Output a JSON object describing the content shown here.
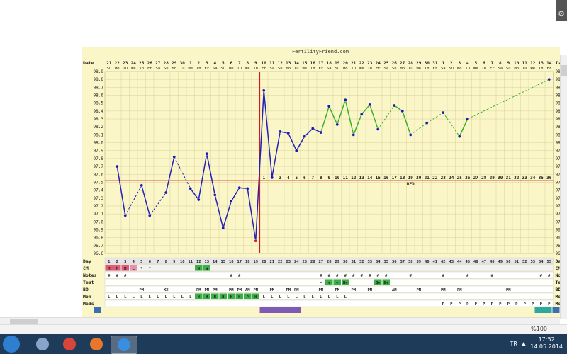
{
  "app": {
    "zoom": "%100",
    "lang": "TR",
    "time": "17:52",
    "date": "14.05.2014"
  },
  "chart": {
    "title": "FertilityFriend.com",
    "row_labels": {
      "date": "Date",
      "day": "Day",
      "cm": "CM",
      "notes": "Notes",
      "test": "Test",
      "bd": "BD",
      "mon": "Mon",
      "meds": "Meds"
    },
    "coverline": 97.52,
    "ovulation_cd": 19,
    "bfo_label": "BFO",
    "ymin": 96.6,
    "ymax": 98.9,
    "yticks": [
      "98.9",
      "98.8",
      "98.7",
      "98.6",
      "98.5",
      "98.4",
      "98.3",
      "98.2",
      "98.1",
      "98.0",
      "97.9",
      "97.8",
      "97.7",
      "97.6",
      "97.5",
      "97.4",
      "97.3",
      "97.2",
      "97.1",
      "97.0",
      "96.9",
      "96.8",
      "96.7",
      "96.6"
    ],
    "dates": [
      "21",
      "22",
      "23",
      "24",
      "25",
      "26",
      "27",
      "28",
      "29",
      "30",
      "1",
      "2",
      "3",
      "4",
      "5",
      "6",
      "7",
      "8",
      "9",
      "10",
      "11",
      "12",
      "13",
      "14",
      "15",
      "16",
      "17",
      "18",
      "19",
      "20",
      "21",
      "22",
      "23",
      "24",
      "25",
      "26",
      "27",
      "28",
      "29",
      "30",
      "31",
      "1",
      "2",
      "3",
      "4",
      "5",
      "6",
      "7",
      "8",
      "9",
      "10",
      "11",
      "12",
      "13",
      "14"
    ],
    "weekdays": [
      "Su",
      "Mo",
      "Tu",
      "We",
      "Th",
      "Fr",
      "Sa",
      "Su",
      "Mo",
      "Tu",
      "We",
      "Th",
      "Fr",
      "Sa",
      "Su",
      "Mo",
      "Tu",
      "We",
      "Th",
      "Fr",
      "Sa",
      "Su",
      "Mo",
      "Tu",
      "We",
      "Th",
      "Fr",
      "Sa",
      "Su",
      "Mo",
      "Tu",
      "We",
      "Th",
      "Fr",
      "Sa",
      "Su",
      "Mo",
      "Tu",
      "We",
      "Th",
      "Fr",
      "Sa",
      "Su",
      "Mo",
      "Tu",
      "We",
      "Th",
      "Fr",
      "Sa",
      "Su",
      "Mo",
      "Tu",
      "We",
      "Th",
      "Fr"
    ],
    "dpo": [
      "1",
      "2",
      "3",
      "4",
      "5",
      "6",
      "7",
      "8",
      "9",
      "10",
      "11",
      "12",
      "13",
      "14",
      "15",
      "16",
      "17",
      "18",
      "19",
      "20",
      "21",
      "22",
      "23",
      "24",
      "25",
      "26",
      "27",
      "28",
      "29",
      "30",
      "31",
      "32",
      "33",
      "34",
      "35",
      "36"
    ],
    "cycle_days": [
      "1",
      "2",
      "3",
      "4",
      "5",
      "6",
      "7",
      "8",
      "9",
      "10",
      "11",
      "12",
      "13",
      "14",
      "15",
      "16",
      "17",
      "18",
      "19",
      "20",
      "21",
      "22",
      "23",
      "24",
      "25",
      "26",
      "27",
      "28",
      "29",
      "30",
      "31",
      "32",
      "33",
      "34",
      "35",
      "36",
      "37",
      "38",
      "39",
      "40",
      "41",
      "42",
      "43",
      "44",
      "45",
      "46",
      "47",
      "48",
      "49",
      "50",
      "51",
      "52",
      "53",
      "54",
      "55"
    ],
    "cm": [
      "M",
      "M",
      "M",
      "L",
      "*",
      "*",
      "",
      "",
      "",
      "",
      "",
      "W",
      "W",
      "",
      "",
      "",
      "",
      "",
      "",
      "",
      "",
      "",
      "",
      "",
      "",
      "",
      "",
      "",
      "",
      "",
      "",
      "",
      "",
      "",
      "",
      "",
      "",
      "",
      "",
      "",
      "",
      "",
      "",
      "",
      "",
      "",
      "",
      "",
      "",
      "",
      "",
      "",
      "",
      "",
      ""
    ],
    "notes": [
      "#",
      "#",
      "#",
      "",
      "",
      "",
      "",
      "",
      "",
      "",
      "",
      "",
      "",
      "",
      "",
      "#",
      "#",
      "",
      "",
      "",
      "",
      "",
      "",
      "",
      "",
      "",
      "#",
      "#",
      "#",
      "#",
      "#",
      "#",
      "#",
      "#",
      "#",
      "",
      "",
      "#",
      "",
      "",
      "",
      "#",
      "",
      "",
      "#",
      "",
      "",
      "#",
      "",
      "",
      "",
      "",
      "",
      "#",
      "#"
    ],
    "test": [
      "",
      "",
      "",
      "",
      "",
      "",
      "",
      "",
      "",
      "",
      "",
      "",
      "",
      "",
      "",
      "",
      "",
      "",
      "",
      "",
      "",
      "",
      "",
      "",
      "",
      "",
      "–",
      "+",
      "+",
      "B+",
      "",
      "",
      "",
      "B+",
      "B+",
      "",
      "",
      "",
      "",
      "",
      "",
      "",
      "",
      "",
      "",
      "",
      "",
      "",
      "",
      "",
      "",
      "",
      "",
      "",
      ""
    ],
    "bd": [
      "",
      "",
      "",
      "",
      "PM",
      "",
      "",
      "XX",
      "",
      "",
      "",
      "PM",
      "PM",
      "PM",
      "",
      "PM",
      "PM",
      "AM",
      "PM",
      "",
      "PM",
      "",
      "PM",
      "PM",
      "",
      "",
      "PM",
      "",
      "PM",
      "",
      "PM",
      "",
      "PM",
      "",
      "",
      "AM",
      "",
      "",
      "PM",
      "",
      "",
      "PM",
      "",
      "PM",
      "",
      "",
      "",
      "",
      "",
      "PM",
      "",
      "",
      "",
      "",
      ""
    ],
    "mon": [
      "L",
      "L",
      "L",
      "L",
      "L",
      "L",
      "L",
      "L",
      "L",
      "L",
      "L",
      "H",
      "H",
      "H",
      "H",
      "H",
      "H",
      "P",
      "H",
      "L",
      "L",
      "L",
      "L",
      "L",
      "L",
      "L",
      "L",
      "L",
      "L",
      "L",
      "",
      "",
      "",
      "",
      "",
      "",
      "",
      "",
      "",
      "",
      "",
      "",
      "",
      "",
      "",
      "",
      "",
      "",
      "",
      "",
      "",
      "",
      "",
      "",
      ""
    ],
    "meds": [
      "",
      "",
      "",
      "",
      "",
      "",
      "",
      "",
      "",
      "",
      "",
      "",
      "",
      "",
      "",
      "",
      "",
      "",
      "",
      "",
      "",
      "",
      "",
      "",
      "",
      "",
      "",
      "",
      "",
      "",
      "",
      "",
      "",
      "",
      "",
      "",
      "",
      "",
      "",
      "",
      "",
      "P",
      "P",
      "P",
      "P",
      "P",
      "P",
      "P",
      "P",
      "P",
      "P",
      "P",
      "P",
      "P",
      "P"
    ]
  },
  "chart_data": {
    "type": "line",
    "title": "FertilityFriend.com",
    "xlabel": "",
    "ylabel": "",
    "ylim": [
      96.6,
      98.9
    ],
    "grid": true,
    "x": [
      1,
      2,
      3,
      4,
      5,
      6,
      7,
      8,
      9,
      10,
      11,
      12,
      13,
      14,
      15,
      16,
      17,
      18,
      19,
      20,
      21,
      22,
      23,
      24,
      25,
      26,
      27,
      28,
      29,
      30,
      31,
      32,
      33,
      34,
      35,
      36,
      37,
      38,
      39,
      40,
      41,
      42,
      43,
      44,
      45,
      46,
      47,
      48,
      49,
      50,
      51,
      52,
      53,
      54,
      55
    ],
    "series": [
      {
        "name": "",
        "values": [
          null,
          97.7,
          97.08,
          null,
          97.46,
          97.08,
          null,
          97.37,
          97.82,
          null,
          97.42,
          97.28,
          97.86,
          97.34,
          96.92,
          97.26,
          97.43,
          97.42,
          96.76,
          98.66,
          97.56,
          98.14,
          98.12,
          97.9,
          98.08,
          98.18,
          98.13,
          98.46,
          98.23,
          98.54,
          98.1,
          98.36,
          98.48,
          98.17,
          null,
          98.47,
          98.4,
          98.1,
          null,
          98.25,
          null,
          98.38,
          null,
          98.08,
          98.3,
          null,
          null,
          null,
          null,
          null,
          null,
          null,
          null,
          null,
          98.8
        ]
      }
    ]
  }
}
